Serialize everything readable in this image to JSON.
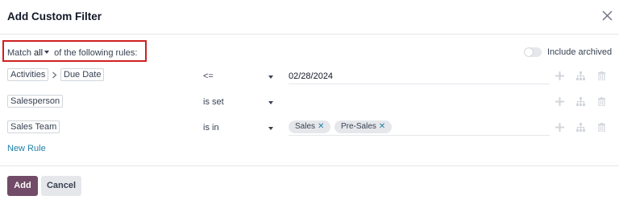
{
  "dialog": {
    "title": "Add Custom Filter"
  },
  "match": {
    "prefix": "Match",
    "selector": "all",
    "suffix": "of the following rules:"
  },
  "include_archived": {
    "label": "Include archived",
    "checked": false
  },
  "rules": [
    {
      "path": [
        "Activities",
        "Due Date"
      ],
      "operator": "<=",
      "value": "02/28/2024",
      "tags": []
    },
    {
      "path": [
        "Salesperson"
      ],
      "operator": "is set",
      "value": "",
      "tags": []
    },
    {
      "path": [
        "Sales Team"
      ],
      "operator": "is in",
      "value": "",
      "tags": [
        "Sales",
        "Pre-Sales"
      ]
    }
  ],
  "new_rule_label": "New Rule",
  "footer": {
    "add_label": "Add",
    "cancel_label": "Cancel"
  },
  "colors": {
    "primary": "#714b67",
    "link": "#1f7fa8",
    "highlight_border": "#d02020"
  },
  "icons": {
    "close": "close-icon",
    "add": "plus-icon",
    "branch": "hierarchy-icon",
    "delete": "trash-icon"
  }
}
